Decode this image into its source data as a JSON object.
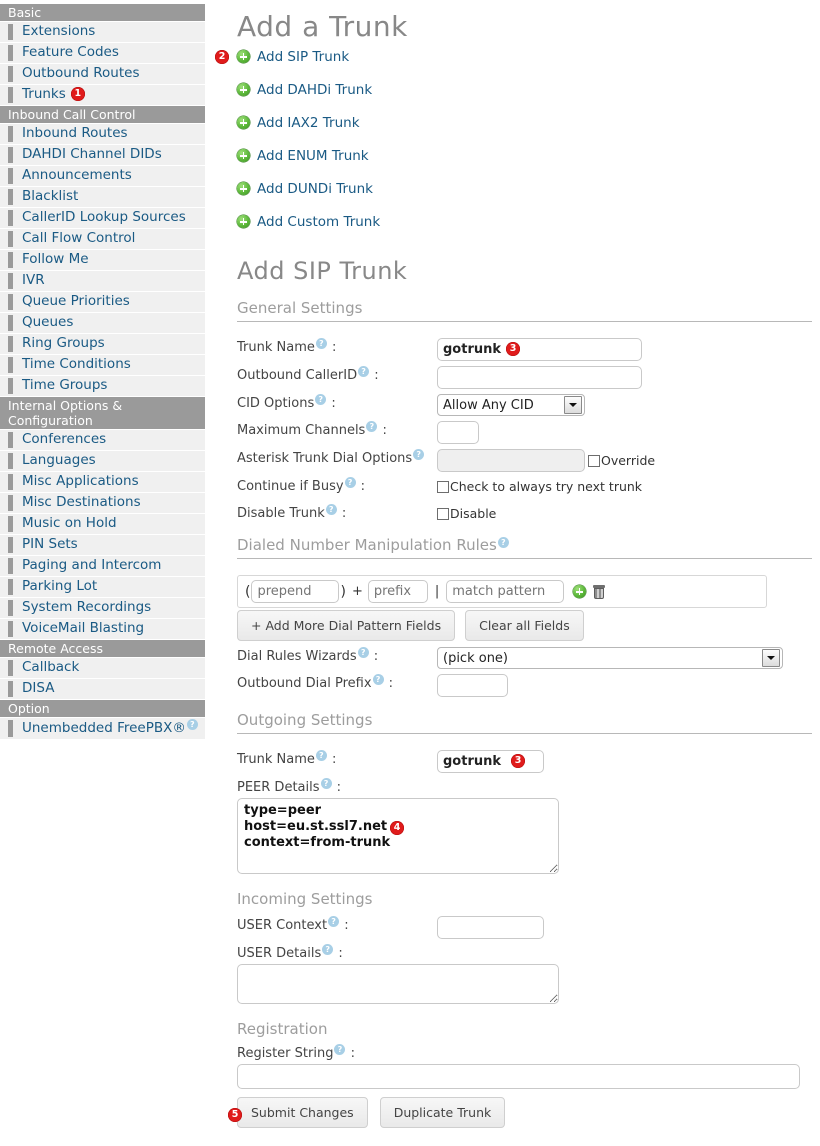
{
  "sidebar": {
    "groups": [
      {
        "header": "Basic",
        "items": [
          {
            "label": "Extensions"
          },
          {
            "label": "Feature Codes"
          },
          {
            "label": "Outbound Routes"
          },
          {
            "label": "Trunks",
            "badge": "1"
          }
        ]
      },
      {
        "header": "Inbound Call Control",
        "items": [
          {
            "label": "Inbound Routes"
          },
          {
            "label": "DAHDI Channel DIDs"
          },
          {
            "label": "Announcements"
          },
          {
            "label": "Blacklist"
          },
          {
            "label": "CallerID Lookup Sources"
          },
          {
            "label": "Call Flow Control"
          },
          {
            "label": "Follow Me"
          },
          {
            "label": "IVR"
          },
          {
            "label": "Queue Priorities"
          },
          {
            "label": "Queues"
          },
          {
            "label": "Ring Groups"
          },
          {
            "label": "Time Conditions"
          },
          {
            "label": "Time Groups"
          }
        ]
      },
      {
        "header": "Internal Options & Configuration",
        "items": [
          {
            "label": "Conferences"
          },
          {
            "label": "Languages"
          },
          {
            "label": "Misc Applications"
          },
          {
            "label": "Misc Destinations"
          },
          {
            "label": "Music on Hold"
          },
          {
            "label": "PIN Sets"
          },
          {
            "label": "Paging and Intercom"
          },
          {
            "label": "Parking Lot"
          },
          {
            "label": "System Recordings"
          },
          {
            "label": "VoiceMail Blasting"
          }
        ]
      },
      {
        "header": "Remote Access",
        "items": [
          {
            "label": "Callback"
          },
          {
            "label": "DISA"
          }
        ]
      },
      {
        "header": "Option",
        "items": [
          {
            "label": "Unembedded FreePBX®",
            "help": true
          }
        ]
      }
    ]
  },
  "main": {
    "page_title": "Add a Trunk",
    "trunk_links": [
      {
        "label": "Add SIP Trunk",
        "badge": "2"
      },
      {
        "label": "Add DAHDi Trunk"
      },
      {
        "label": "Add IAX2 Trunk"
      },
      {
        "label": "Add ENUM Trunk"
      },
      {
        "label": "Add DUNDi Trunk"
      },
      {
        "label": "Add Custom Trunk"
      }
    ],
    "form_title": "Add SIP Trunk",
    "general": {
      "heading": "General Settings",
      "trunk_name_label": "Trunk Name",
      "trunk_name_value": "gotrunk",
      "trunk_name_badge": "3",
      "outbound_cid_label": "Outbound CallerID",
      "outbound_cid_value": "",
      "cid_options_label": "CID Options",
      "cid_options_value": "Allow Any CID",
      "max_channels_label": "Maximum Channels",
      "max_channels_value": "",
      "dial_options_label": "Asterisk Trunk Dial Options",
      "dial_options_value": "",
      "override_label": "Override",
      "continue_busy_label": "Continue if Busy",
      "continue_busy_checkbox_label": "Check to always try next trunk",
      "disable_trunk_label": "Disable Trunk",
      "disable_checkbox_label": "Disable"
    },
    "dial_rules": {
      "heading": "Dialed Number Manipulation Rules",
      "prepend_placeholder": "prepend",
      "prefix_placeholder": "prefix",
      "match_placeholder": "match pattern",
      "open_paren": "(",
      "close_paren": ")",
      "plus_sign": "+",
      "pipe_sign": "|",
      "add_fields_button": "+ Add More Dial Pattern Fields",
      "clear_fields_button": "Clear all Fields",
      "wizards_label": "Dial Rules Wizards",
      "wizards_value": "(pick one)",
      "outbound_prefix_label": "Outbound Dial Prefix",
      "outbound_prefix_value": ""
    },
    "outgoing": {
      "heading": "Outgoing Settings",
      "trunk_name_label": "Trunk Name",
      "trunk_name_value": "gotrunk",
      "trunk_name_badge": "3",
      "peer_details_label": "PEER Details",
      "peer_details_value": "type=peer\nhost=eu.st.ssl7.net\ncontext=from-trunk",
      "peer_details_badge": "4"
    },
    "incoming": {
      "heading": "Incoming Settings",
      "user_context_label": "USER Context",
      "user_context_value": "",
      "user_details_label": "USER Details",
      "user_details_value": ""
    },
    "registration": {
      "heading": "Registration",
      "register_string_label": "Register String",
      "register_string_value": ""
    },
    "actions": {
      "submit_label": "Submit Changes",
      "submit_badge": "5",
      "duplicate_label": "Duplicate Trunk"
    }
  },
  "colors": {
    "badge_red": "#e01b1b",
    "link_blue": "#1a5a84",
    "header_gray": "#9a9a9a",
    "plus_green": "#5cb83a"
  }
}
